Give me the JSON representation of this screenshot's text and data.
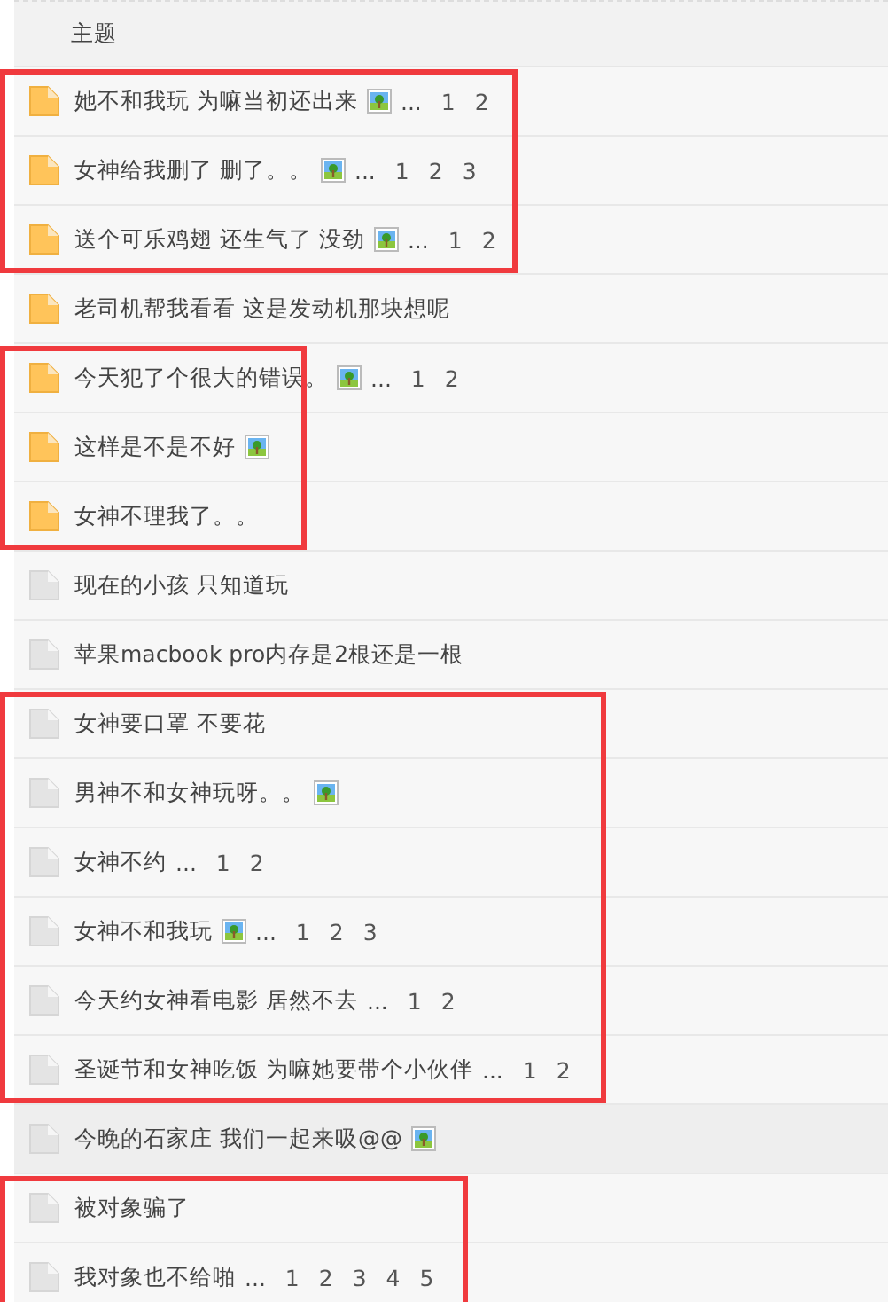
{
  "header": {
    "title": "主题"
  },
  "groups": [
    {
      "boxed": true,
      "rows": [
        {
          "title": "她不和我玩 为嘛当初还出来",
          "new": true,
          "image": true,
          "pages": [
            "1",
            "2"
          ]
        },
        {
          "title": "女神给我删了 删了。。",
          "new": true,
          "image": true,
          "pages": [
            "1",
            "2",
            "3"
          ]
        },
        {
          "title": "送个可乐鸡翅 还生气了 没劲",
          "new": true,
          "image": true,
          "pages": [
            "1",
            "2"
          ]
        }
      ]
    },
    {
      "boxed": false,
      "rows": [
        {
          "title": "老司机帮我看看 这是发动机那块想呢",
          "new": true,
          "image": false
        }
      ]
    },
    {
      "boxed": true,
      "rows": [
        {
          "title": "今天犯了个很大的错误。",
          "new": true,
          "image": true,
          "pages": [
            "1",
            "2"
          ]
        },
        {
          "title": "这样是不是不好",
          "new": true,
          "image": true
        },
        {
          "title": "女神不理我了。。",
          "new": true,
          "image": false
        }
      ]
    },
    {
      "boxed": false,
      "rows": [
        {
          "title": "现在的小孩 只知道玩",
          "new": false,
          "image": false
        },
        {
          "title": "苹果macbook pro内存是2根还是一根",
          "new": false,
          "image": false
        }
      ]
    },
    {
      "boxed": true,
      "rows": [
        {
          "title": "女神要口罩 不要花",
          "new": false,
          "image": false
        },
        {
          "title": "男神不和女神玩呀。。",
          "new": false,
          "image": true
        },
        {
          "title": "女神不约",
          "new": false,
          "image": false,
          "pages": [
            "1",
            "2"
          ]
        },
        {
          "title": "女神不和我玩",
          "new": false,
          "image": true,
          "pages": [
            "1",
            "2",
            "3"
          ]
        },
        {
          "title": "今天约女神看电影 居然不去",
          "new": false,
          "image": false,
          "pages": [
            "1",
            "2"
          ]
        },
        {
          "title": "圣诞节和女神吃饭 为嘛她要带个小伙伴",
          "new": false,
          "image": false,
          "pages": [
            "1",
            "2"
          ]
        }
      ]
    },
    {
      "boxed": false,
      "rows": [
        {
          "title": "今晚的石家庄 我们一起来吸@@",
          "new": false,
          "image": true,
          "highlighted": true
        }
      ]
    },
    {
      "boxed": true,
      "rows": [
        {
          "title": "被对象骗了",
          "new": false,
          "image": false
        },
        {
          "title": "我对象也不给啪",
          "new": false,
          "image": false,
          "pages": [
            "1",
            "2",
            "3",
            "4",
            "5"
          ]
        }
      ]
    }
  ],
  "ellipsis": "..."
}
